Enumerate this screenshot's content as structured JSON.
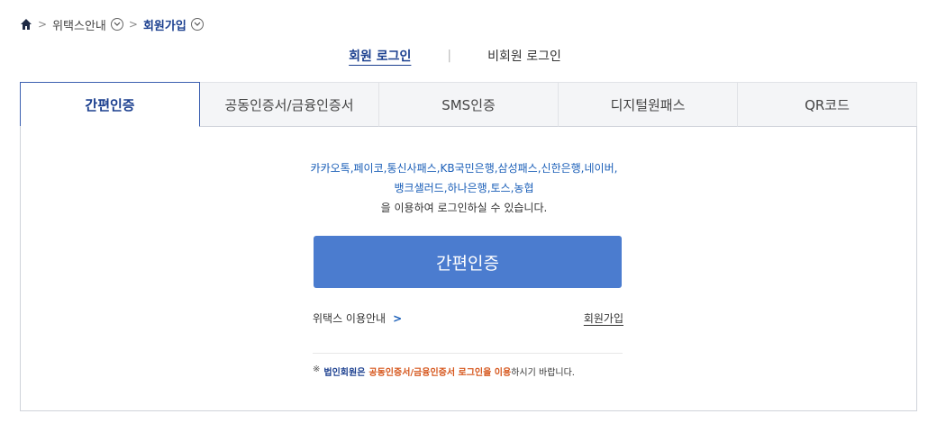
{
  "breadcrumb": {
    "items": [
      "위택스안내",
      "회원가입"
    ]
  },
  "login_switch": {
    "member": "회원 로그인",
    "divider": "|",
    "guest": "비회원 로그인"
  },
  "tabs": [
    {
      "label": "간편인증",
      "active": true
    },
    {
      "label": "공동인증서/금융인증서",
      "active": false
    },
    {
      "label": "SMS인증",
      "active": false
    },
    {
      "label": "디지털원패스",
      "active": false
    },
    {
      "label": "QR코드",
      "active": false
    }
  ],
  "content": {
    "providers_line1": "카카오톡,페이코,통신사패스,KB국민은행,삼성패스,신한은행,네이버,",
    "providers_line2": "뱅크샐러드,하나은행,토스,농협",
    "desc_line3": "을 이용하여 로그인하실 수 있습니다.",
    "button_label": "간편인증",
    "guide_link": "위택스 이용안내",
    "guide_arrow": ">",
    "signup_link": "회원가입"
  },
  "notice": {
    "mark": "※",
    "part1": "법인회원은",
    "part2": "공동인증서/금융인증서 로그인을 이용",
    "part3": "하시기 바랍니다."
  },
  "colors": {
    "accent": "#1b3f8f",
    "button": "#4b7ccf",
    "warning": "#d6561c"
  }
}
